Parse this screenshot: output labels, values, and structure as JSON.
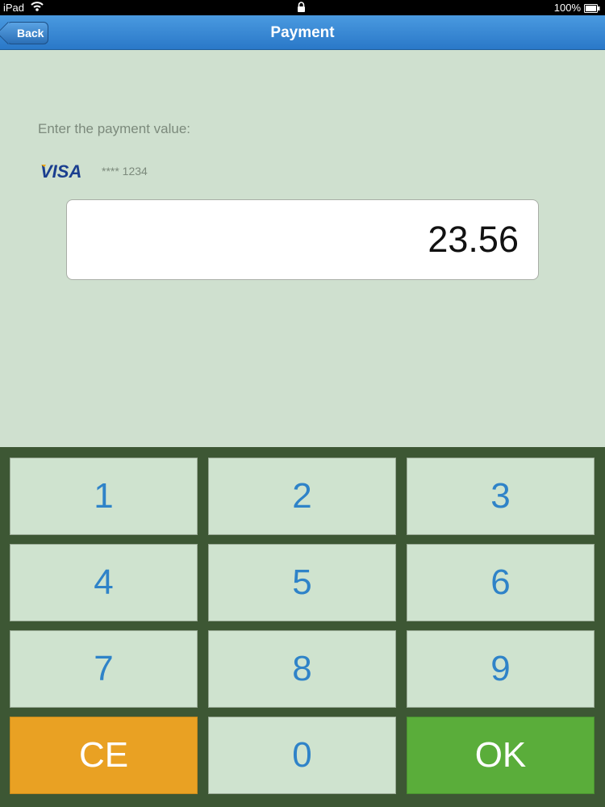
{
  "statusbar": {
    "device": "iPad",
    "battery": "100%"
  },
  "nav": {
    "back_label": "Back",
    "title": "Payment"
  },
  "form": {
    "prompt": "Enter the payment value:",
    "card_brand": "VISA",
    "card_number": "**** 1234",
    "amount": "23.56"
  },
  "keypad": {
    "k1": "1",
    "k2": "2",
    "k3": "3",
    "k4": "4",
    "k5": "5",
    "k6": "6",
    "k7": "7",
    "k8": "8",
    "k9": "9",
    "ce": "CE",
    "k0": "0",
    "ok": "OK"
  },
  "colors": {
    "nav": "#2a78c8",
    "background": "#cfe0cf",
    "keypad_bg": "#3d5734",
    "key_text": "#2f83c8",
    "ce": "#e9a123",
    "ok": "#5aad3a"
  },
  "icons": [
    "wifi-icon",
    "lock-icon",
    "battery-icon",
    "visa-logo"
  ]
}
